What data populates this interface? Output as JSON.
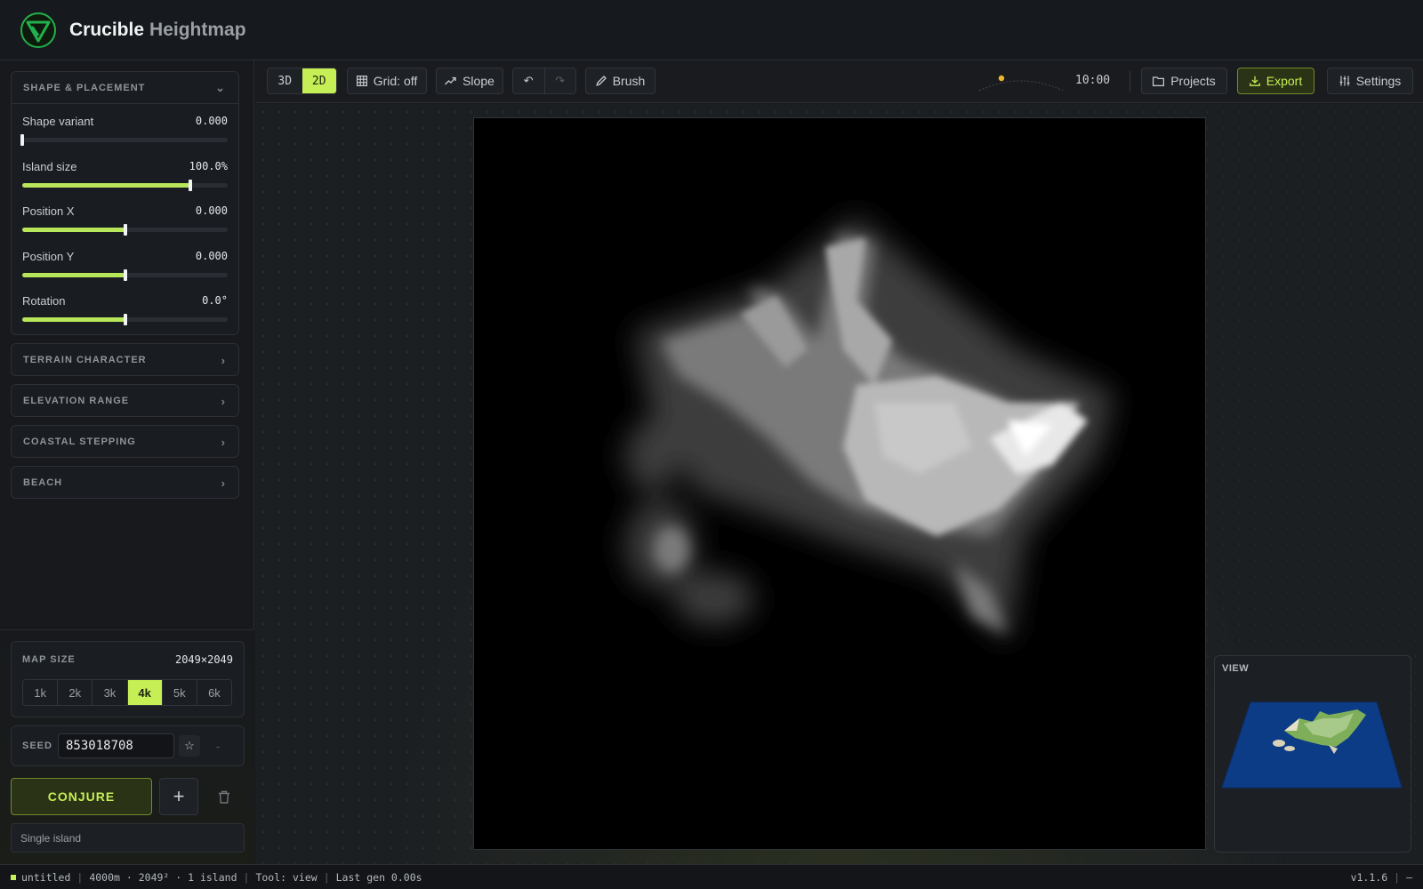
{
  "app": {
    "title": "Crucible",
    "subtitle": "Heightmap",
    "brand_color": "#c5ef55"
  },
  "sidebar": {
    "shape_panel": {
      "title": "SHAPE & PLACEMENT",
      "sliders": [
        {
          "label": "Shape variant",
          "value": "0.000",
          "fraction": 0.0
        },
        {
          "label": "Island size",
          "value": "100.0%",
          "fraction": 0.82
        },
        {
          "label": "Position X",
          "value": "0.000",
          "fraction": 0.5
        },
        {
          "label": "Position Y",
          "value": "0.000",
          "fraction": 0.5
        },
        {
          "label": "Rotation",
          "value": "0.0°",
          "fraction": 0.5
        }
      ]
    },
    "collapsed_panels": [
      "TERRAIN CHARACTER",
      "ELEVATION RANGE",
      "COASTAL STEPPING",
      "BEACH"
    ],
    "map_size": {
      "label": "MAP SIZE",
      "value": "2049×2049",
      "options": [
        "1k",
        "2k",
        "3k",
        "4k",
        "5k",
        "6k"
      ],
      "selected": "4k"
    },
    "seed": {
      "label": "SEED",
      "value": "853018708",
      "star_icon": "☆",
      "dash": "-"
    },
    "conjure_label": "CONJURE",
    "plus_label": "+",
    "mode": "Single island"
  },
  "toolbar": {
    "view_3d": "3D",
    "view_2d": "2D",
    "grid": "Grid: off",
    "slope": "Slope",
    "undo_icon": "↶",
    "redo_icon": "↷",
    "brush": "Brush",
    "time": "10:00",
    "projects": "Projects",
    "export": "Export",
    "settings": "Settings"
  },
  "minimap": {
    "label": "VIEW"
  },
  "status": {
    "file": "untitled",
    "info": "4000m · 2049² · 1 island",
    "tool": "Tool: view",
    "last_gen": "Last gen 0.00s",
    "version": "v1.1.6",
    "tail": "—"
  }
}
